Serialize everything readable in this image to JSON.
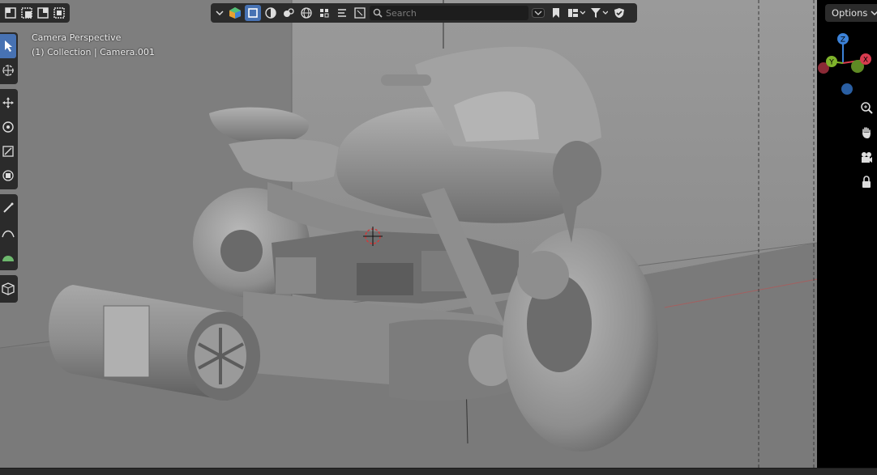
{
  "viewport": {
    "overlay_line1": "Camera Perspective",
    "overlay_line2": "(1) Collection | Camera.001"
  },
  "header": {
    "search_placeholder": "Search",
    "options_label": "Options"
  },
  "gizmo": {
    "x_label": "X",
    "y_label": "Y",
    "z_label": "Z",
    "colors": {
      "x": "#d83b4e",
      "y": "#7fb32b",
      "z": "#3c82d8"
    }
  },
  "theme": {
    "accent": "#4772b3",
    "header_bg": "#2b2b2b",
    "viewport_bg": "#787878"
  }
}
